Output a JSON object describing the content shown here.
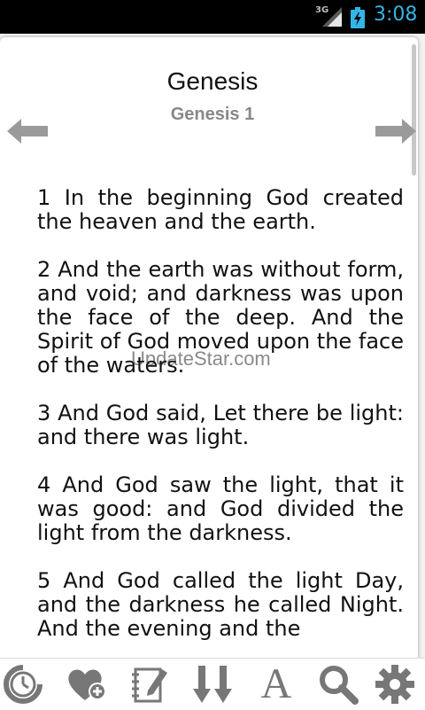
{
  "status_bar": {
    "network": "3G",
    "time": "3:08"
  },
  "header": {
    "book": "Genesis",
    "chapter": "Genesis 1"
  },
  "verses": [
    "1 In the beginning God created the heaven and the earth.",
    "2 And the earth was without form, and void; and darkness was upon the face of the deep. And the Spirit of God moved upon the face of the waters.",
    "3 And God said, Let there be light: and there was light.",
    "4 And God saw the light, that it was good: and God divided the light from the darkness.",
    "5 And God called the light Day, and the darkness he called Night. And the evening and the"
  ],
  "watermark": "UpdateStar.com",
  "toolbar": {
    "items": [
      {
        "icon": "clock-icon"
      },
      {
        "icon": "heart-add-icon"
      },
      {
        "icon": "notebook-edit-icon"
      },
      {
        "icon": "scroll-down-icon"
      },
      {
        "icon": "font-icon",
        "label": "A"
      },
      {
        "icon": "search-icon"
      },
      {
        "icon": "gear-icon"
      }
    ]
  },
  "colors": {
    "accent": "#33b5e5",
    "icon_gray": "#777777",
    "arrow_gray": "#9a9a9a"
  }
}
